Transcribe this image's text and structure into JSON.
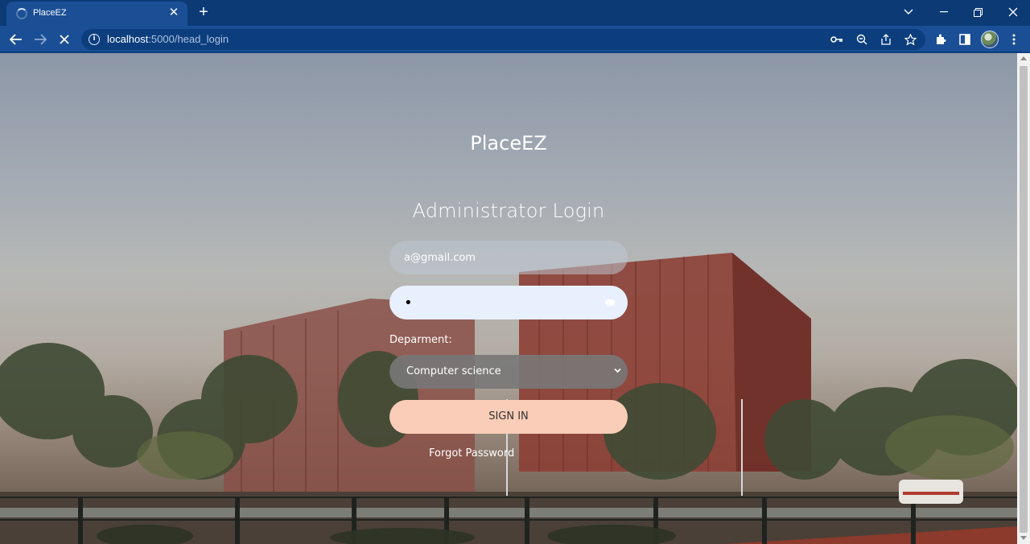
{
  "browser": {
    "tab_title": "PlaceEZ",
    "url_host": "localhost",
    "url_path": ":5000/head_login"
  },
  "page": {
    "brand": "PlaceEZ",
    "heading": "Administrator Login",
    "email_value": "a@gmail.com",
    "password_value": "•",
    "department_label": "Deparment:",
    "department_selected": "Computer science",
    "signin_label": "SIGN IN",
    "forgot_label": "Forgot Password"
  },
  "colors": {
    "chrome": "#0b3a75",
    "toolbar": "#1a4f96",
    "signin": "#f9cdb7",
    "password_fill": "#e8f0fe"
  },
  "icons": [
    "loading-spinner-icon",
    "close-icon",
    "plus-icon",
    "chevron-down-icon",
    "minimize-icon",
    "restore-icon",
    "back-arrow-icon",
    "forward-arrow-icon",
    "stop-icon",
    "info-icon",
    "key-icon",
    "zoom-icon",
    "share-icon",
    "star-icon",
    "extensions-icon",
    "side-panel-icon",
    "menu-dots-icon"
  ]
}
